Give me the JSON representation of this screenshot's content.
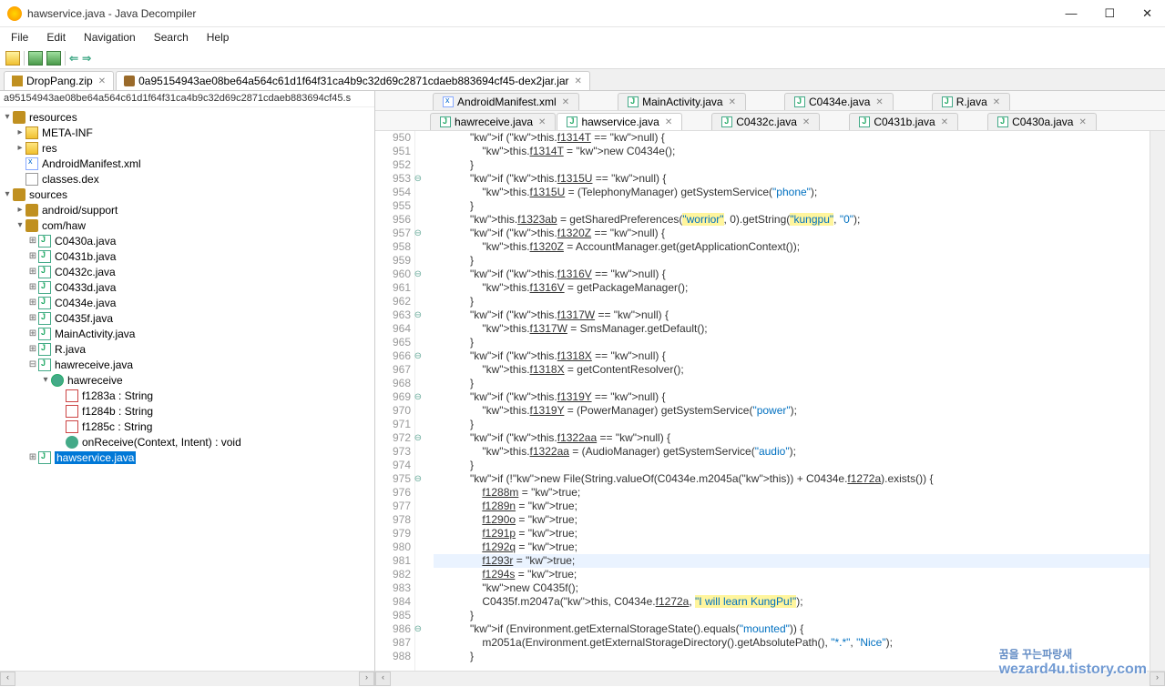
{
  "window": {
    "title": "hawservice.java - Java Decompiler"
  },
  "menu": {
    "file": "File",
    "edit": "Edit",
    "navigation": "Navigation",
    "search": "Search",
    "help": "Help"
  },
  "topTabs": {
    "t1": "DropPang.zip",
    "t2": "0a95154943ae08be64a564c61d1f64f31ca4b9c32d69c2871cdaeb883694cf45-dex2jar.jar"
  },
  "sidebar": {
    "path": "a95154943ae08be64a564c61d1f64f31ca4b9c32d69c2871cdaeb883694cf45.s",
    "resources": "resources",
    "metainf": "META-INF",
    "res": "res",
    "manifest": "AndroidManifest.xml",
    "classes": "classes.dex",
    "sources": "sources",
    "android": "android/support",
    "comhaw": "com/haw",
    "c0430a": "C0430a.java",
    "c0431b": "C0431b.java",
    "c0432c": "C0432c.java",
    "c0433d": "C0433d.java",
    "c0434e": "C0434e.java",
    "c0435f": "C0435f.java",
    "mainact": "MainActivity.java",
    "rjava": "R.java",
    "hawrecv": "hawreceive.java",
    "hawrecvcls": "hawreceive",
    "f1283a": "f1283a : String",
    "f1284b": "f1284b : String",
    "f1285c": "f1285c : String",
    "onrecv": "onReceive(Context, Intent) : void",
    "hawsvc": "hawservice.java"
  },
  "editorTabs": {
    "r1": {
      "t1": "AndroidManifest.xml",
      "t2": "MainActivity.java",
      "t3": "C0434e.java",
      "t4": "R.java"
    },
    "r2": {
      "t1": "hawreceive.java",
      "t2": "hawservice.java",
      "t3": "C0432c.java",
      "t4": "C0431b.java",
      "t5": "C0430a.java"
    }
  },
  "code": {
    "lines": [
      "950",
      "951",
      "952",
      "953",
      "954",
      "955",
      "956",
      "957",
      "958",
      "959",
      "960",
      "961",
      "962",
      "963",
      "964",
      "965",
      "966",
      "967",
      "968",
      "969",
      "970",
      "971",
      "972",
      "973",
      "974",
      "975",
      "976",
      "977",
      "978",
      "979",
      "980",
      "981",
      "982",
      "983",
      "984",
      "985",
      "986",
      "987",
      "988"
    ],
    "l950": "            if (this.f1314T == null) {",
    "l951": "                this.f1314T = new C0434e();",
    "l952": "            }",
    "l953": "            if (this.f1315U == null) {",
    "l954": "                this.f1315U = (TelephonyManager) getSystemService(\"phone\");",
    "l955": "            }",
    "l956a": "            this.f1323ab = getSharedPreferences(",
    "l956b": "\"worrior\"",
    "l956c": ", 0).getString(",
    "l956d": "\"kungpu\"",
    "l956e": ", \"0\");",
    "l957": "            if (this.f1320Z == null) {",
    "l958": "                this.f1320Z = AccountManager.get(getApplicationContext());",
    "l959": "            }",
    "l960": "            if (this.f1316V == null) {",
    "l961": "                this.f1316V = getPackageManager();",
    "l962": "            }",
    "l963": "            if (this.f1317W == null) {",
    "l964": "                this.f1317W = SmsManager.getDefault();",
    "l965": "            }",
    "l966": "            if (this.f1318X == null) {",
    "l967": "                this.f1318X = getContentResolver();",
    "l968": "            }",
    "l969": "            if (this.f1319Y == null) {",
    "l970": "                this.f1319Y = (PowerManager) getSystemService(\"power\");",
    "l971": "            }",
    "l972": "            if (this.f1322aa == null) {",
    "l973": "                this.f1322aa = (AudioManager) getSystemService(\"audio\");",
    "l974": "            }",
    "l975": "            if (!new File(String.valueOf(C0434e.m2045a(this)) + C0434e.f1272a).exists()) {",
    "l976": "                f1288m = true;",
    "l977": "                f1289n = true;",
    "l978": "                f1290o = true;",
    "l979": "                f1291p = true;",
    "l980": "                f1292q = true;",
    "l981": "                f1293r = true;",
    "l982": "                f1294s = true;",
    "l983": "                new C0435f();",
    "l984a": "                C0435f.m2047a(this, C0434e.f1272a, ",
    "l984b": "\"I will learn KungPu!\"",
    "l984c": ");",
    "l985": "            }",
    "l986": "            if (Environment.getExternalStorageState().equals(\"mounted\")) {",
    "l987": "                m2051a(Environment.getExternalStorageDirectory().getAbsolutePath(), \"*.*\", \"Nice\");",
    "l988": "            }"
  },
  "watermark": {
    "l1": "꿈을 꾸는파랑새",
    "l2": "wezard4u.tistory.com"
  }
}
